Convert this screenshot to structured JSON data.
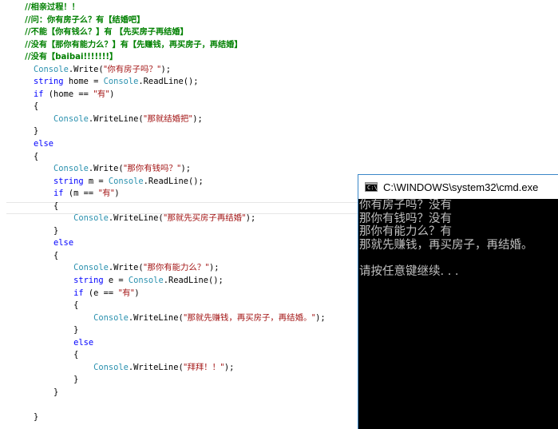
{
  "editor": {
    "lines": [
      [
        {
          "t": "    //相亲过程！！",
          "c": "cm"
        }
      ],
      [
        {
          "t": "    //问：你有房子么？有【结婚吧】",
          "c": "cm"
        }
      ],
      [
        {
          "t": "    //不能【你有钱么？】有 【先买房子再结婚】",
          "c": "cm"
        }
      ],
      [
        {
          "t": "    //没有【那你有能力么？】有【先赚钱，再买房子，再结婚】",
          "c": "cm"
        }
      ],
      [
        {
          "t": "    //没有【baibai!!!!!!!】",
          "c": "cm"
        }
      ],
      [
        {
          "t": "    ",
          "c": "tx"
        },
        {
          "t": "Console",
          "c": "ty"
        },
        {
          "t": ".Write(",
          "c": "tx"
        },
        {
          "t": "\"你有房子吗？\"",
          "c": "st"
        },
        {
          "t": ");",
          "c": "tx"
        }
      ],
      [
        {
          "t": "    ",
          "c": "tx"
        },
        {
          "t": "string",
          "c": "kw"
        },
        {
          "t": " home = ",
          "c": "tx"
        },
        {
          "t": "Console",
          "c": "ty"
        },
        {
          "t": ".ReadLine();",
          "c": "tx"
        }
      ],
      [
        {
          "t": "    ",
          "c": "tx"
        },
        {
          "t": "if",
          "c": "kw"
        },
        {
          "t": " (home == ",
          "c": "tx"
        },
        {
          "t": "\"有\"",
          "c": "st"
        },
        {
          "t": ")",
          "c": "tx"
        }
      ],
      [
        {
          "t": "    {",
          "c": "tx"
        }
      ],
      [
        {
          "t": "        ",
          "c": "tx"
        },
        {
          "t": "Console",
          "c": "ty"
        },
        {
          "t": ".WriteLine(",
          "c": "tx"
        },
        {
          "t": "\"那就结婚把\"",
          "c": "st"
        },
        {
          "t": ");",
          "c": "tx"
        }
      ],
      [
        {
          "t": "    }",
          "c": "tx"
        }
      ],
      [
        {
          "t": "    ",
          "c": "tx"
        },
        {
          "t": "else",
          "c": "kw"
        }
      ],
      [
        {
          "t": "    {",
          "c": "tx"
        }
      ],
      [
        {
          "t": "        ",
          "c": "tx"
        },
        {
          "t": "Console",
          "c": "ty"
        },
        {
          "t": ".Write(",
          "c": "tx"
        },
        {
          "t": "\"那你有钱吗？\"",
          "c": "st"
        },
        {
          "t": ");",
          "c": "tx"
        }
      ],
      [
        {
          "t": "        ",
          "c": "tx"
        },
        {
          "t": "string",
          "c": "kw"
        },
        {
          "t": " m = ",
          "c": "tx"
        },
        {
          "t": "Console",
          "c": "ty"
        },
        {
          "t": ".ReadLine();",
          "c": "tx"
        }
      ],
      [
        {
          "t": "        ",
          "c": "tx"
        },
        {
          "t": "if",
          "c": "kw"
        },
        {
          "t": " (m == ",
          "c": "tx"
        },
        {
          "t": "\"有\"",
          "c": "st"
        },
        {
          "t": ")",
          "c": "tx"
        }
      ],
      [
        {
          "t": "        {",
          "c": "tx"
        }
      ],
      [
        {
          "t": "            ",
          "c": "tx"
        },
        {
          "t": "Console",
          "c": "ty"
        },
        {
          "t": ".WriteLine(",
          "c": "tx"
        },
        {
          "t": "\"那就先买房子再结婚\"",
          "c": "st"
        },
        {
          "t": ");",
          "c": "tx"
        }
      ],
      [
        {
          "t": "        }",
          "c": "tx"
        }
      ],
      [
        {
          "t": "        ",
          "c": "tx"
        },
        {
          "t": "else",
          "c": "kw"
        }
      ],
      [
        {
          "t": "        {",
          "c": "tx"
        }
      ],
      [
        {
          "t": "            ",
          "c": "tx"
        },
        {
          "t": "Console",
          "c": "ty"
        },
        {
          "t": ".Write(",
          "c": "tx"
        },
        {
          "t": "\"那你有能力么？\"",
          "c": "st"
        },
        {
          "t": ");",
          "c": "tx"
        }
      ],
      [
        {
          "t": "            ",
          "c": "tx"
        },
        {
          "t": "string",
          "c": "kw"
        },
        {
          "t": " e = ",
          "c": "tx"
        },
        {
          "t": "Console",
          "c": "ty"
        },
        {
          "t": ".ReadLine();",
          "c": "tx"
        }
      ],
      [
        {
          "t": "            ",
          "c": "tx"
        },
        {
          "t": "if",
          "c": "kw"
        },
        {
          "t": " (e == ",
          "c": "tx"
        },
        {
          "t": "\"有\"",
          "c": "st"
        },
        {
          "t": ")",
          "c": "tx"
        }
      ],
      [
        {
          "t": "            {",
          "c": "tx"
        }
      ],
      [
        {
          "t": "                ",
          "c": "tx"
        },
        {
          "t": "Console",
          "c": "ty"
        },
        {
          "t": ".WriteLine(",
          "c": "tx"
        },
        {
          "t": "\"那就先赚钱，再买房子，再结婚。\"",
          "c": "st"
        },
        {
          "t": ");",
          "c": "tx"
        }
      ],
      [
        {
          "t": "            }",
          "c": "tx"
        }
      ],
      [
        {
          "t": "            ",
          "c": "tx"
        },
        {
          "t": "else",
          "c": "kw"
        }
      ],
      [
        {
          "t": "            {",
          "c": "tx"
        }
      ],
      [
        {
          "t": "                ",
          "c": "tx"
        },
        {
          "t": "Console",
          "c": "ty"
        },
        {
          "t": ".WriteLine(",
          "c": "tx"
        },
        {
          "t": "\"拜拜！！\"",
          "c": "st"
        },
        {
          "t": ");",
          "c": "tx"
        }
      ],
      [
        {
          "t": "            }",
          "c": "tx"
        }
      ],
      [
        {
          "t": "        }",
          "c": "tx"
        }
      ],
      [
        {
          "t": "",
          "c": "tx"
        }
      ],
      [
        {
          "t": "    }",
          "c": "tx"
        }
      ]
    ]
  },
  "cmd": {
    "icon_text": "C:\\",
    "title": "C:\\WINDOWS\\system32\\cmd.exe",
    "output": [
      "你有房子吗？没有",
      "那你有钱吗？没有",
      "那你有能力么？有",
      "那就先赚钱，再买房子，再结婚。",
      "",
      "请按任意键继续. . ."
    ]
  },
  "colors": {
    "comment": "#008000",
    "keyword": "#0000ff",
    "type": "#2b91af",
    "string": "#a31515",
    "console_text": "#c0c0c0",
    "console_bg": "#000000"
  }
}
